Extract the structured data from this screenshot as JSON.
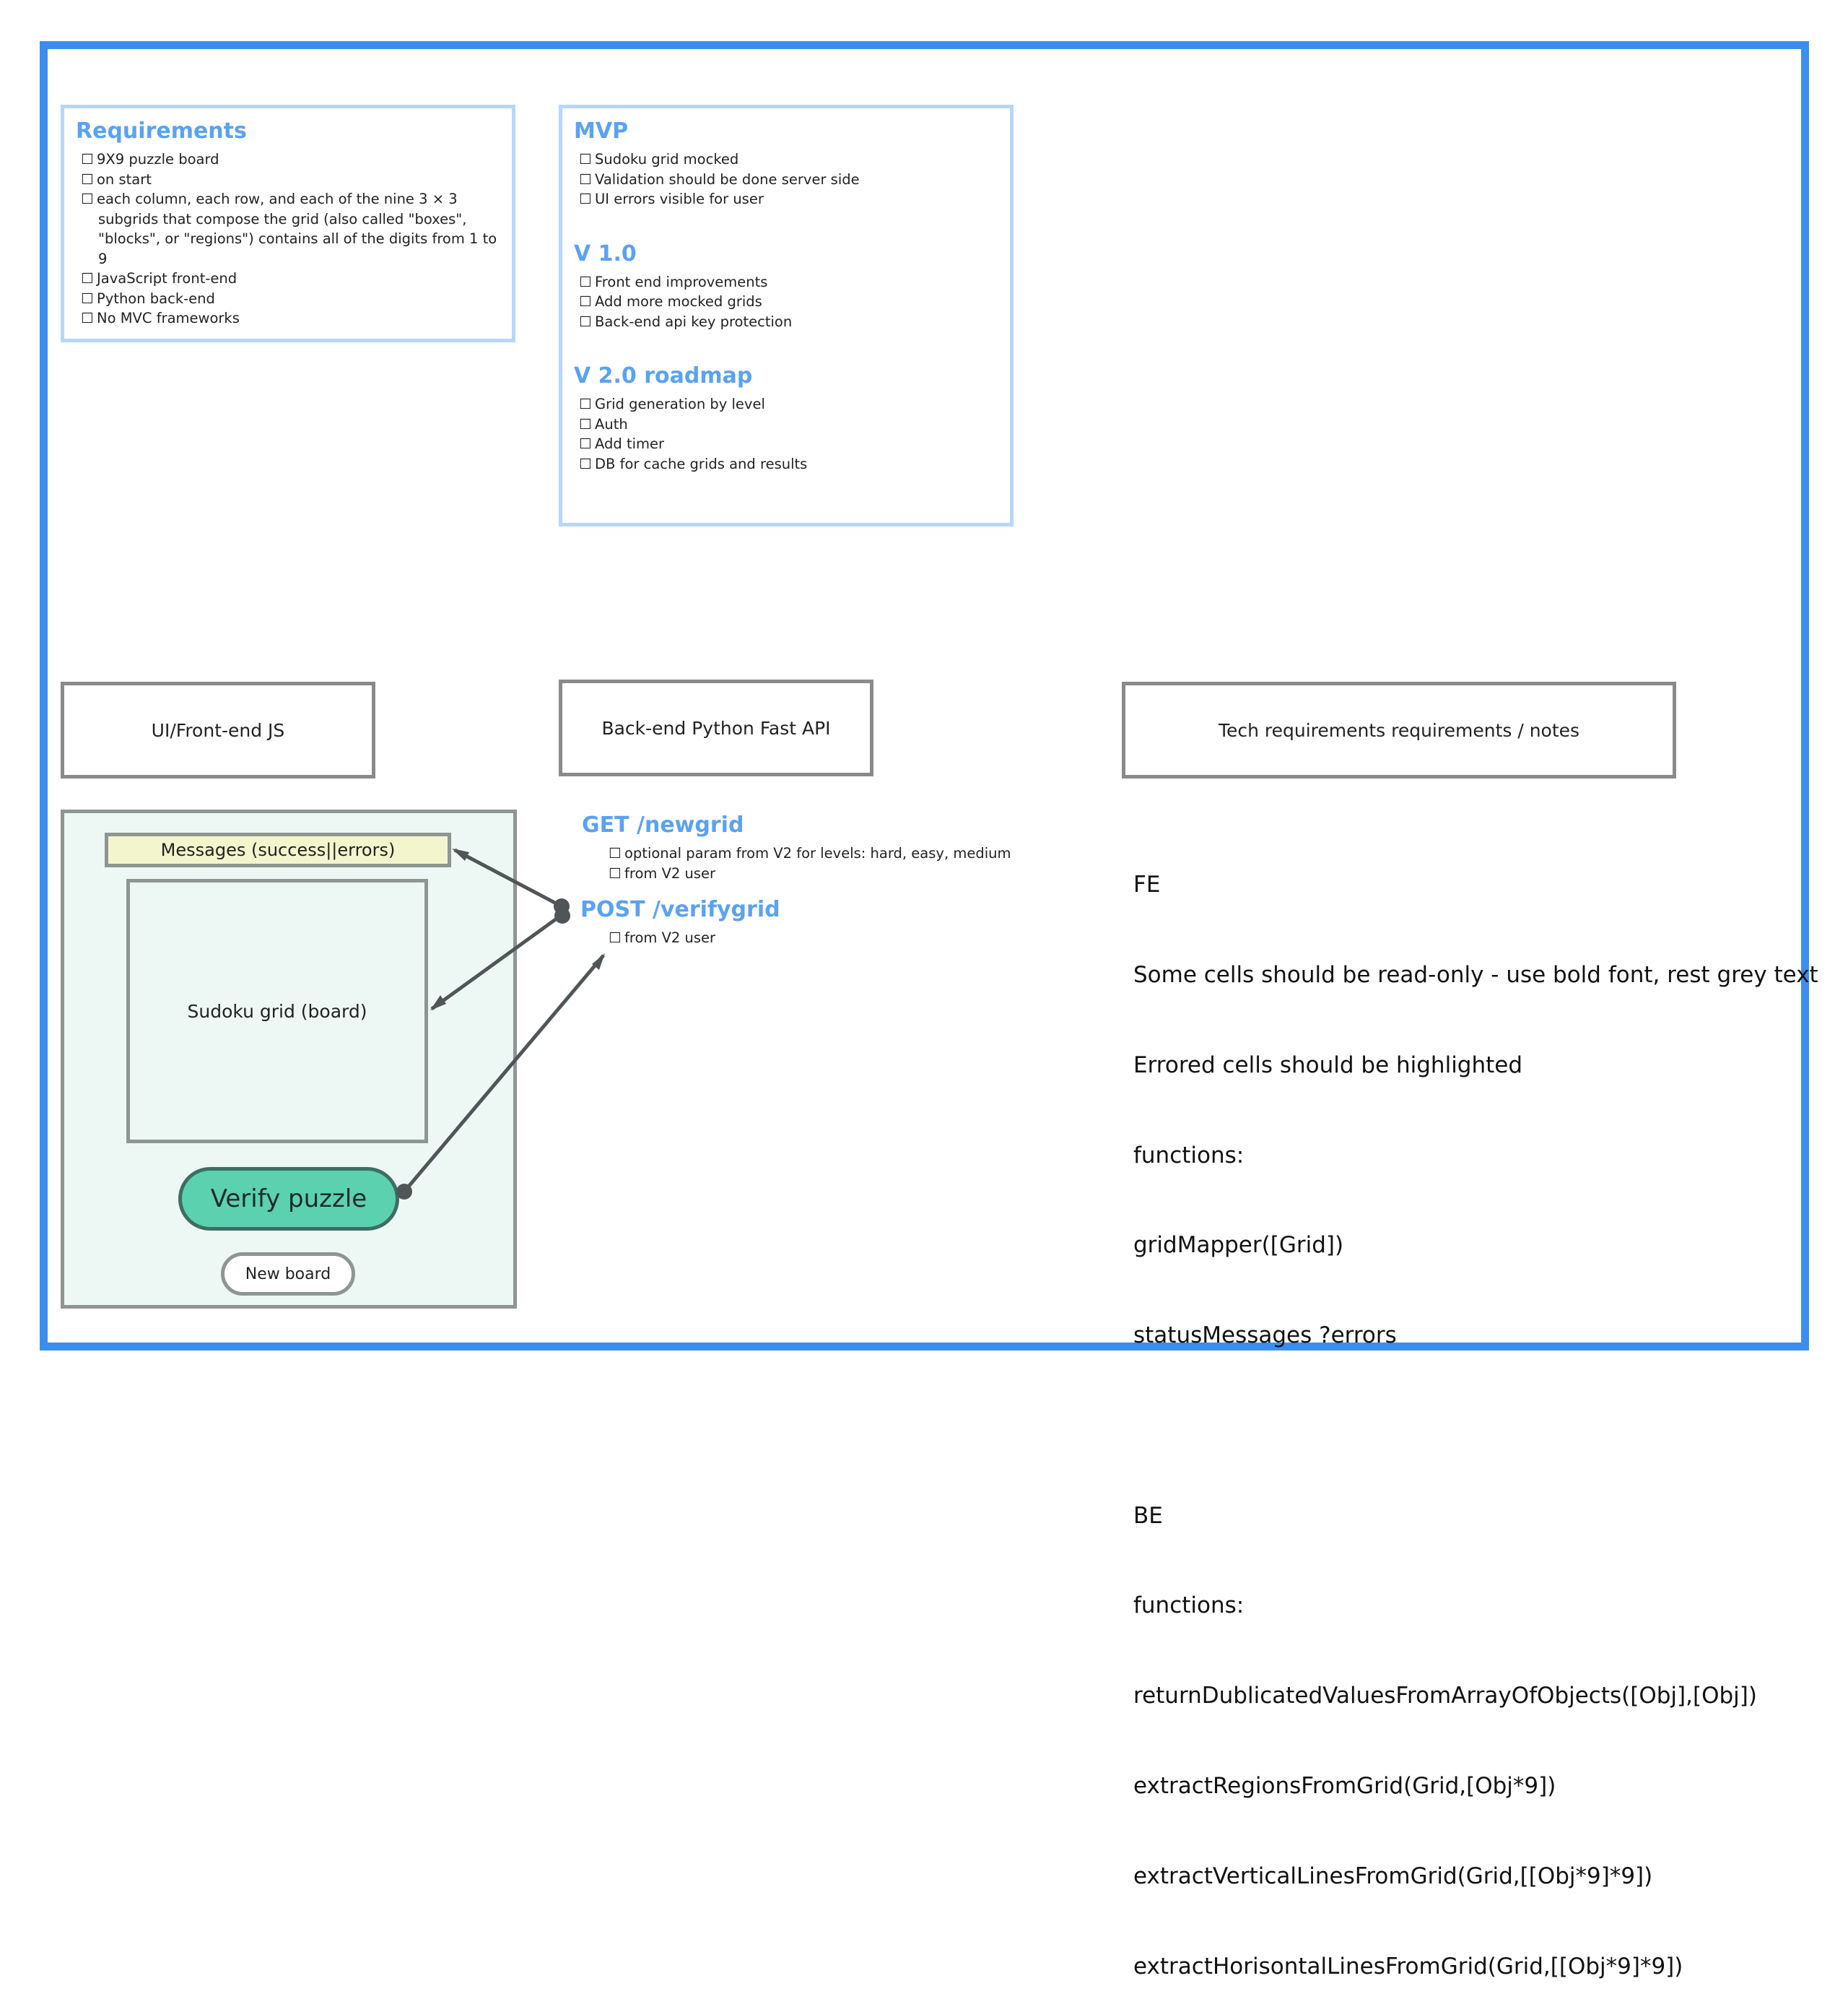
{
  "requirements": {
    "title": "Requirements",
    "items": [
      "9X9 puzzle board",
      "on start",
      "each column, each row, and each of the nine 3 × 3 subgrids that compose the grid (also called \"boxes\", \"blocks\", or \"regions\") contains all of the digits from 1 to 9",
      "JavaScript front-end",
      "Python back-end",
      "No MVC frameworks"
    ]
  },
  "roadmap": {
    "mvp": {
      "title": "MVP",
      "items": [
        "Sudoku grid mocked",
        "Validation should be done server side",
        "UI errors visible for user"
      ]
    },
    "v1": {
      "title": "V 1.0",
      "items": [
        "Front end improvements",
        "Add more mocked grids",
        "Back-end api key protection"
      ]
    },
    "v2": {
      "title": "V 2.0 roadmap",
      "items": [
        "Grid generation by level",
        "Auth",
        "Add timer",
        "DB for cache grids and results"
      ]
    }
  },
  "headers": {
    "frontend": "UI/Front-end JS",
    "backend": "Back-end Python Fast API",
    "tech": "Tech requirements requirements / notes"
  },
  "ui_mock": {
    "messages": "Messages (success||errors)",
    "grid": "Sudoku grid (board)",
    "verify_button": "Verify puzzle",
    "new_board_button": "New board"
  },
  "api": {
    "endpoints": [
      {
        "title": "GET /newgrid",
        "items": [
          "optional param from V2 for levels: hard, easy, medium",
          "from V2 user"
        ]
      },
      {
        "title": "POST /verifygrid",
        "items": [
          "from V2 user"
        ]
      }
    ]
  },
  "notes": {
    "lines": [
      "FE",
      "Some cells should be read-only - use bold font, rest grey text",
      "Errored cells should be highlighted",
      "functions:",
      "gridMapper([Grid])",
      "statusMessages ?errors",
      "",
      "BE",
      "functions:",
      "returnDublicatedValuesFromArrayOfObjects([Obj],[Obj])",
      "extractRegionsFromGrid(Grid,[Obj*9])",
      "extractVerticalLinesFromGrid(Grid,[[Obj*9]*9])",
      "extractHorisontalLinesFromGrid(Grid,[[Obj*9]*9])"
    ]
  },
  "colors": {
    "frame": "#3b8ef0",
    "heading": "#5aa2f2",
    "panel_border": "#b7d6fb",
    "ui_background": "#edf8f5",
    "messages_fill": "#f3f5cc",
    "verify_fill": "#5bd1b0",
    "connector": "#505558"
  }
}
